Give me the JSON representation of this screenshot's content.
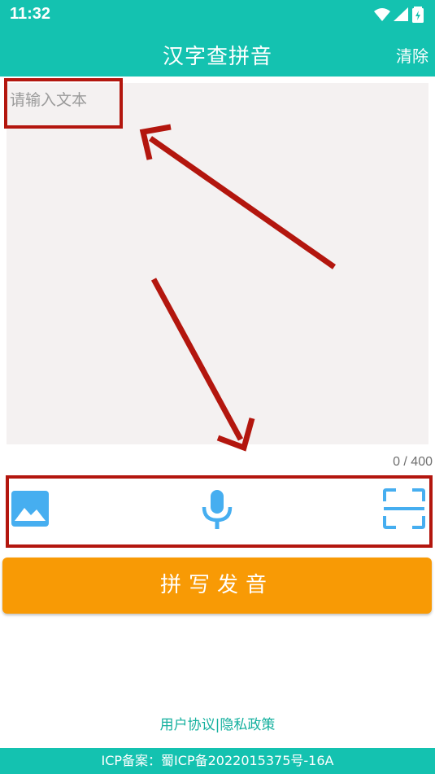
{
  "status_bar": {
    "time": "11:32",
    "icons": [
      "wifi-icon",
      "signal-icon",
      "battery-charging-icon"
    ]
  },
  "app_bar": {
    "title": "汉字查拼音",
    "clear_label": "清除"
  },
  "input": {
    "placeholder": "请输入文本",
    "value": "",
    "counter": "0 / 400"
  },
  "tools": {
    "image_icon": "image-icon",
    "mic_icon": "microphone-icon",
    "scan_icon": "scan-icon"
  },
  "primary_button": {
    "label": "拼写发音"
  },
  "footer": {
    "user_agreement": "用户协议",
    "separator": "|",
    "privacy_policy": "隐私政策",
    "icp": "ICP备案：蜀ICP备2022015375号-16A"
  },
  "colors": {
    "teal": "#14c2b0",
    "orange": "#f89a05",
    "input_bg": "#f4f1f1",
    "tool_blue": "#46aef0",
    "annotation_red": "#b3160e"
  }
}
